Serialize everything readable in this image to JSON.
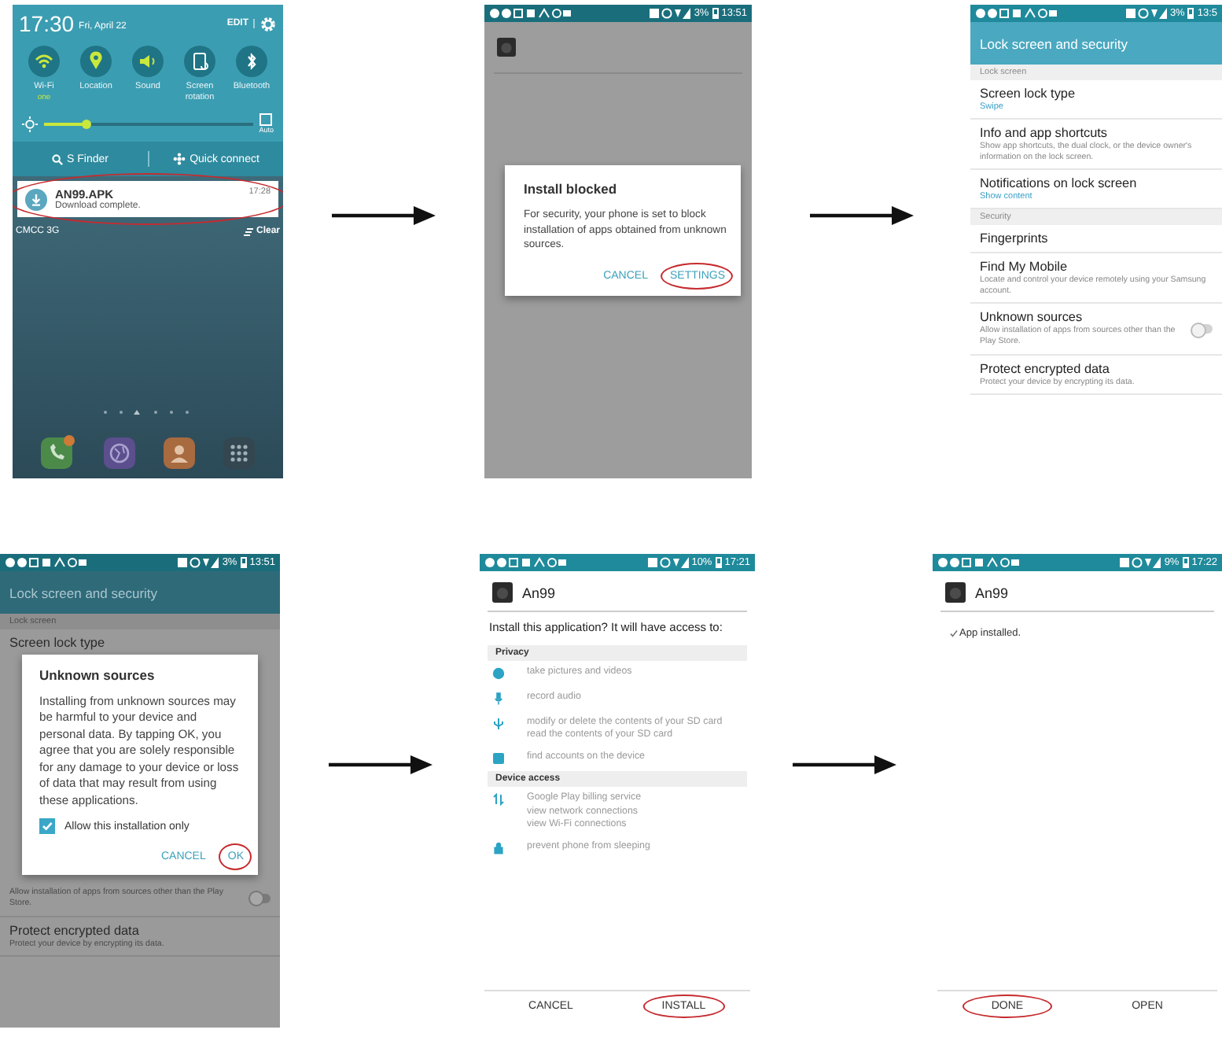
{
  "panels": [
    {
      "kind": "notification_shade",
      "time": "17:30",
      "date": "Fri, April 22",
      "edit": "EDIT",
      "toggles": [
        {
          "label": "Wi-Fi",
          "sub": "one",
          "on": true
        },
        {
          "label": "Location",
          "on": true
        },
        {
          "label": "Sound",
          "on": true
        },
        {
          "label": "Screen rotation",
          "on": false
        },
        {
          "label": "Bluetooth",
          "on": false
        }
      ],
      "brightness": {
        "level": 0.2,
        "auto": "Auto",
        "auto_checked": false
      },
      "finder": "S Finder",
      "quick_connect": "Quick connect",
      "notification": {
        "title": "AN99.APK",
        "text": "Download complete.",
        "time": "17:28",
        "circled": true
      },
      "carrier": "CMCC 3G",
      "clear": "Clear"
    },
    {
      "kind": "dialog_over_app",
      "status": {
        "battery": "3%",
        "time": "13:51"
      },
      "dialog": {
        "title": "Install blocked",
        "text": "For security, your phone is set to block installation of apps obtained from unknown sources.",
        "buttons": [
          {
            "label": "CANCEL",
            "circled": false
          },
          {
            "label": "SETTINGS",
            "circled": true
          }
        ]
      }
    },
    {
      "kind": "settings",
      "status": {
        "battery": "3%",
        "time": "13:5"
      },
      "title": "Lock screen and security",
      "items": [
        {
          "kind": "section",
          "title": "Lock screen"
        },
        {
          "kind": "setting",
          "title": "Screen lock type",
          "value": "Swipe"
        },
        {
          "kind": "setting",
          "title": "Info and app shortcuts",
          "summary": "Show app shortcuts, the dual clock, or the device owner's information on the lock screen."
        },
        {
          "kind": "setting",
          "title": "Notifications on lock screen",
          "value": "Show content"
        },
        {
          "kind": "section",
          "title": "Security"
        },
        {
          "kind": "setting",
          "title": "Fingerprints"
        },
        {
          "kind": "setting",
          "title": "Find My Mobile",
          "summary": "Locate and control your device remotely using your Samsung account."
        },
        {
          "kind": "switch",
          "title": "Unknown sources",
          "summary": "Allow installation of apps from sources other than the Play Store.",
          "on": false
        },
        {
          "kind": "setting",
          "title": "Protect encrypted data",
          "summary": "Protect your device by encrypting its data."
        }
      ]
    },
    {
      "kind": "settings_dialog",
      "status": {
        "battery": "3%",
        "time": "13:51"
      },
      "title": "Lock screen and security",
      "items_above": [
        {
          "kind": "section",
          "title": "Lock screen"
        },
        {
          "kind": "setting",
          "title": "Screen lock type"
        }
      ],
      "dialog": {
        "title": "Unknown sources",
        "text": "Installing from unknown sources may be harmful to your device and personal data. By tapping OK, you agree that you are solely responsible for any damage to your device or loss of data that may result from using these applications.",
        "checkbox": {
          "label": "Allow this installation only",
          "checked": true
        },
        "buttons": [
          {
            "label": "CANCEL",
            "circled": false
          },
          {
            "label": "OK",
            "circled": true
          }
        ]
      },
      "items_below": [
        {
          "kind": "switch",
          "summary": "Allow installation of apps from sources other than the Play Store.",
          "on": false
        },
        {
          "kind": "setting",
          "title": "Protect encrypted data",
          "summary": "Protect your device by encrypting its data."
        }
      ]
    },
    {
      "kind": "install",
      "status": {
        "battery": "10%",
        "time": "17:21"
      },
      "app_name": "An99",
      "prompt": "Install this application? It will have access to:",
      "sections": [
        {
          "title": "Privacy",
          "permissions": [
            {
              "lines": [
                "take pictures and videos"
              ]
            },
            {
              "lines": [
                "record audio"
              ]
            },
            {
              "lines": [
                "modify or delete the contents of your SD card",
                "read the contents of your SD card"
              ]
            },
            {
              "lines": [
                "find accounts on the device"
              ]
            }
          ]
        },
        {
          "title": "Device access",
          "permissions": [
            {
              "lines": [
                "Google Play billing service",
                "view network connections",
                "view Wi-Fi connections"
              ]
            },
            {
              "lines": [
                "prevent phone from sleeping"
              ]
            }
          ]
        }
      ],
      "buttons": [
        {
          "label": "CANCEL",
          "circled": false
        },
        {
          "label": "INSTALL",
          "circled": true
        }
      ]
    },
    {
      "kind": "installed",
      "status": {
        "battery": "9%",
        "time": "17:22"
      },
      "app_name": "An99",
      "message": "App installed.",
      "buttons": [
        {
          "label": "DONE",
          "circled": true
        },
        {
          "label": "OPEN",
          "circled": false
        }
      ]
    }
  ]
}
